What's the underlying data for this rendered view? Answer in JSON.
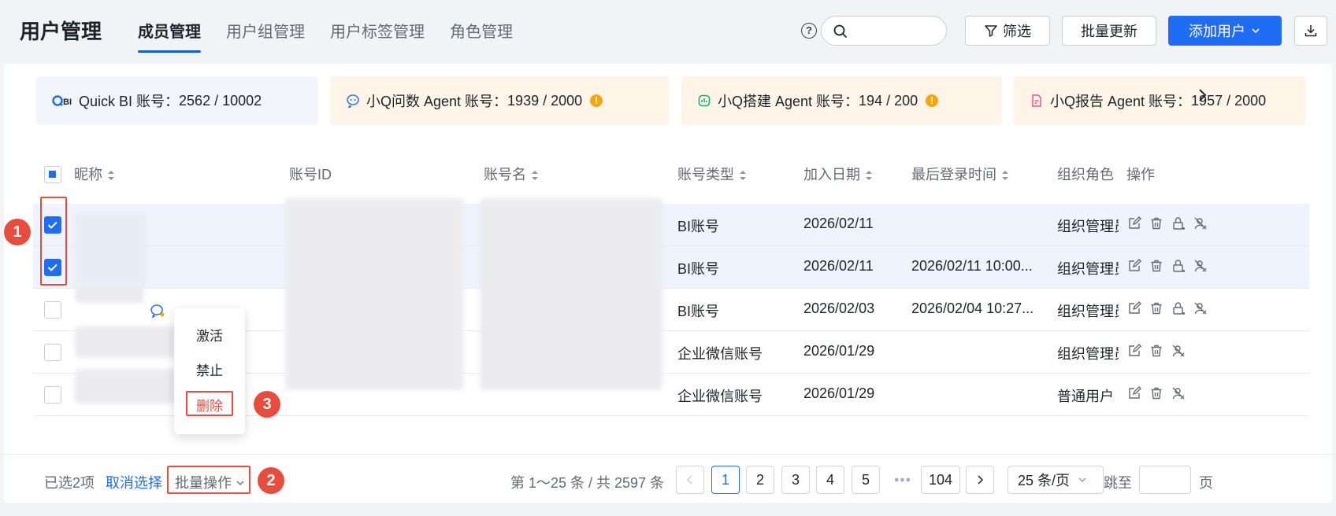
{
  "header": {
    "title": "用户管理",
    "tabs": [
      "成员管理",
      "用户组管理",
      "用户标签管理",
      "角色管理"
    ],
    "help_icon": "?",
    "search_placeholder": "",
    "filter_label": "筛选",
    "batch_update_label": "批量更新",
    "add_user_label": "添加用户"
  },
  "quota_cards": [
    {
      "icon": "quickbi-logo",
      "label": "Quick BI 账号：",
      "count": "2562 / 10002"
    },
    {
      "icon": "chat-agent-icon",
      "label": "小Q问数 Agent 账号：",
      "count": "1939 / 2000",
      "warning": "!"
    },
    {
      "icon": "build-agent-icon",
      "label": "小Q搭建 Agent 账号：",
      "count": "194 / 200",
      "warning": "!"
    },
    {
      "icon": "report-agent-icon",
      "label": "小Q报告 Agent 账号：",
      "count": "1957 / 2000"
    }
  ],
  "table": {
    "columns": [
      "昵称",
      "账号ID",
      "账号名",
      "账号类型",
      "加入日期",
      "最后登录时间",
      "组织角色",
      "操作"
    ],
    "rows": [
      {
        "type": "BI账号",
        "joined": "2026/02/11",
        "last_login": "",
        "role": "组织管理员",
        "selected": true
      },
      {
        "type": "BI账号",
        "joined": "2026/02/11",
        "last_login": "2026/02/11 10:00...",
        "role": "组织管理员",
        "selected": true
      },
      {
        "type": "BI账号",
        "joined": "2026/02/03",
        "last_login": "2026/02/04 10:27...",
        "role": "组织管理员",
        "selected": false
      },
      {
        "type": "企业微信账号",
        "joined": "2026/01/29",
        "last_login": "",
        "role": "组织管理员",
        "selected": false
      },
      {
        "type": "企业微信账号",
        "joined": "2026/01/29",
        "last_login": "",
        "role": "普通用户",
        "selected": false
      }
    ]
  },
  "batch_menu": {
    "items": [
      "激活",
      "禁止",
      "删除"
    ]
  },
  "annotations": [
    "1",
    "2",
    "3"
  ],
  "footer": {
    "selected_text": "已选2项",
    "cancel_label": "取消选择",
    "batch_label": "批量操作",
    "total_text": "第 1～25 条 / 共 2597 条",
    "pages": [
      "1",
      "2",
      "3",
      "4",
      "5"
    ],
    "ellipsis": "•••",
    "last_page": "104",
    "page_size": "25 条/页",
    "jump_label": "跳至",
    "page_unit": "页"
  },
  "colors": {
    "accent": "#1f6cf5",
    "danger": "#e84c3d",
    "warning": "#f5a70a"
  }
}
